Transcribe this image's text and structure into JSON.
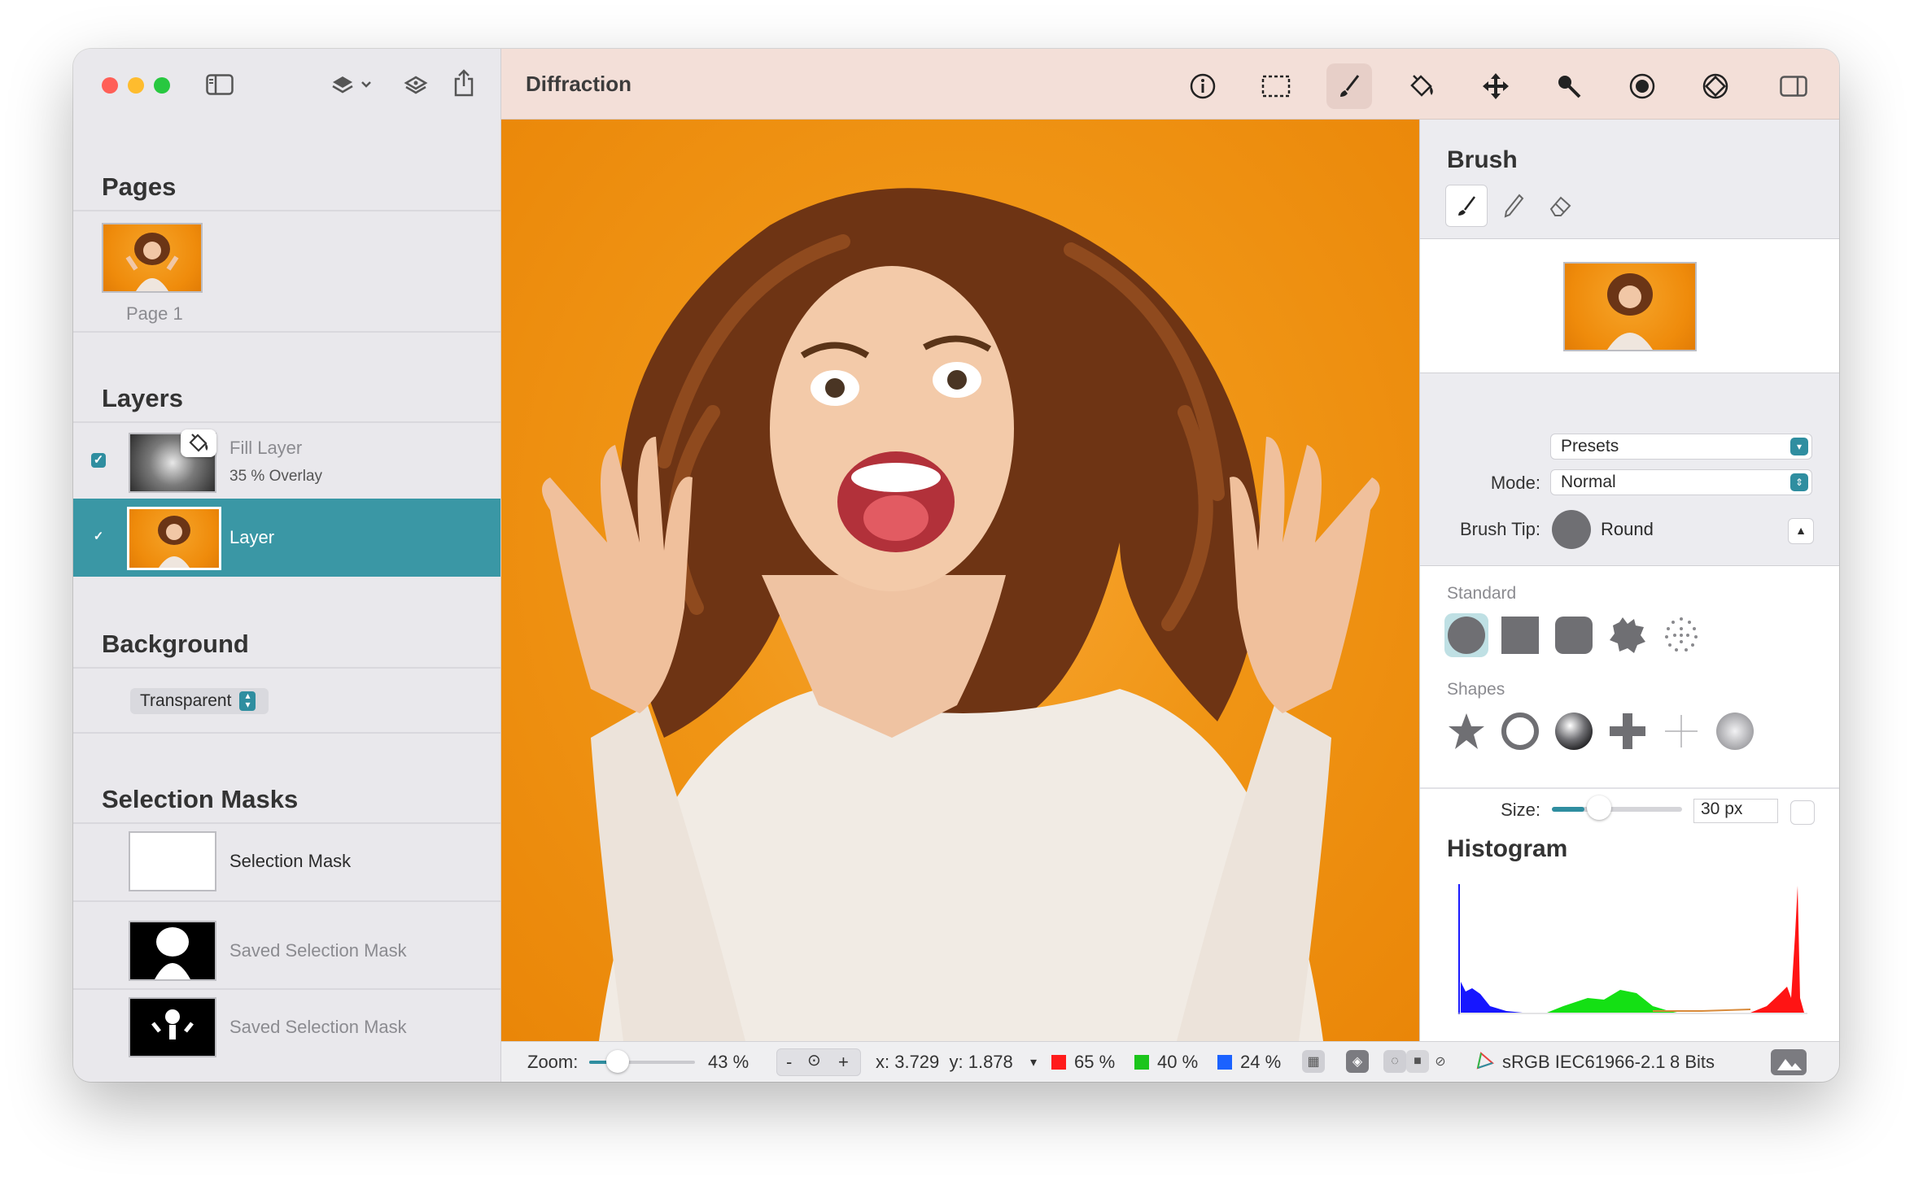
{
  "window": {
    "title": "Diffraction"
  },
  "colors": {
    "accent": "#3a97a5",
    "close": "#ff5f57",
    "minimize": "#febc2e",
    "zoom": "#28c840",
    "canvas_bg": "#f09515"
  },
  "sidebar": {
    "pages_title": "Pages",
    "page_label": "Page 1",
    "layers_title": "Layers",
    "layers": [
      {
        "name": "Fill Layer",
        "detail": "35 % Overlay",
        "visible": true,
        "selected": false
      },
      {
        "name": "Layer",
        "detail": "",
        "visible": true,
        "selected": true
      }
    ],
    "background_title": "Background",
    "background_value": "Transparent",
    "masks_title": "Selection Masks",
    "masks": [
      {
        "name": "Selection Mask"
      },
      {
        "name": "Saved Selection Mask"
      },
      {
        "name": "Saved Selection Mask"
      }
    ]
  },
  "toolbar": {
    "icons": [
      "sidebar-toggle-icon",
      "layers-stack-icon",
      "layer-add-icon",
      "share-icon",
      "info-icon",
      "rect-select-icon",
      "brush-icon",
      "fill-bucket-icon",
      "move-icon",
      "magic-wand-icon",
      "selection-circle-icon",
      "mask-icon",
      "inspector-toggle-icon"
    ]
  },
  "inspector": {
    "brush_title": "Brush",
    "presets_label": "Presets",
    "mode_label": "Mode:",
    "mode_value": "Normal",
    "tip_label": "Brush Tip:",
    "tip_value": "Round",
    "standard_label": "Standard",
    "shapes_label": "Shapes",
    "size_label": "Size:",
    "size_value": "30 px",
    "histogram_title": "Histogram"
  },
  "status": {
    "zoom_label": "Zoom:",
    "zoom_value": "43 %",
    "zoom_fraction": 0.43,
    "zoom_minus": "-",
    "zoom_plus": "+",
    "coords": "x: 3.729  y: 1.878",
    "red": "65 %",
    "green": "40 %",
    "blue": "24 %",
    "profile": "sRGB IEC61966-2.1",
    "bits": "8 Bits"
  }
}
